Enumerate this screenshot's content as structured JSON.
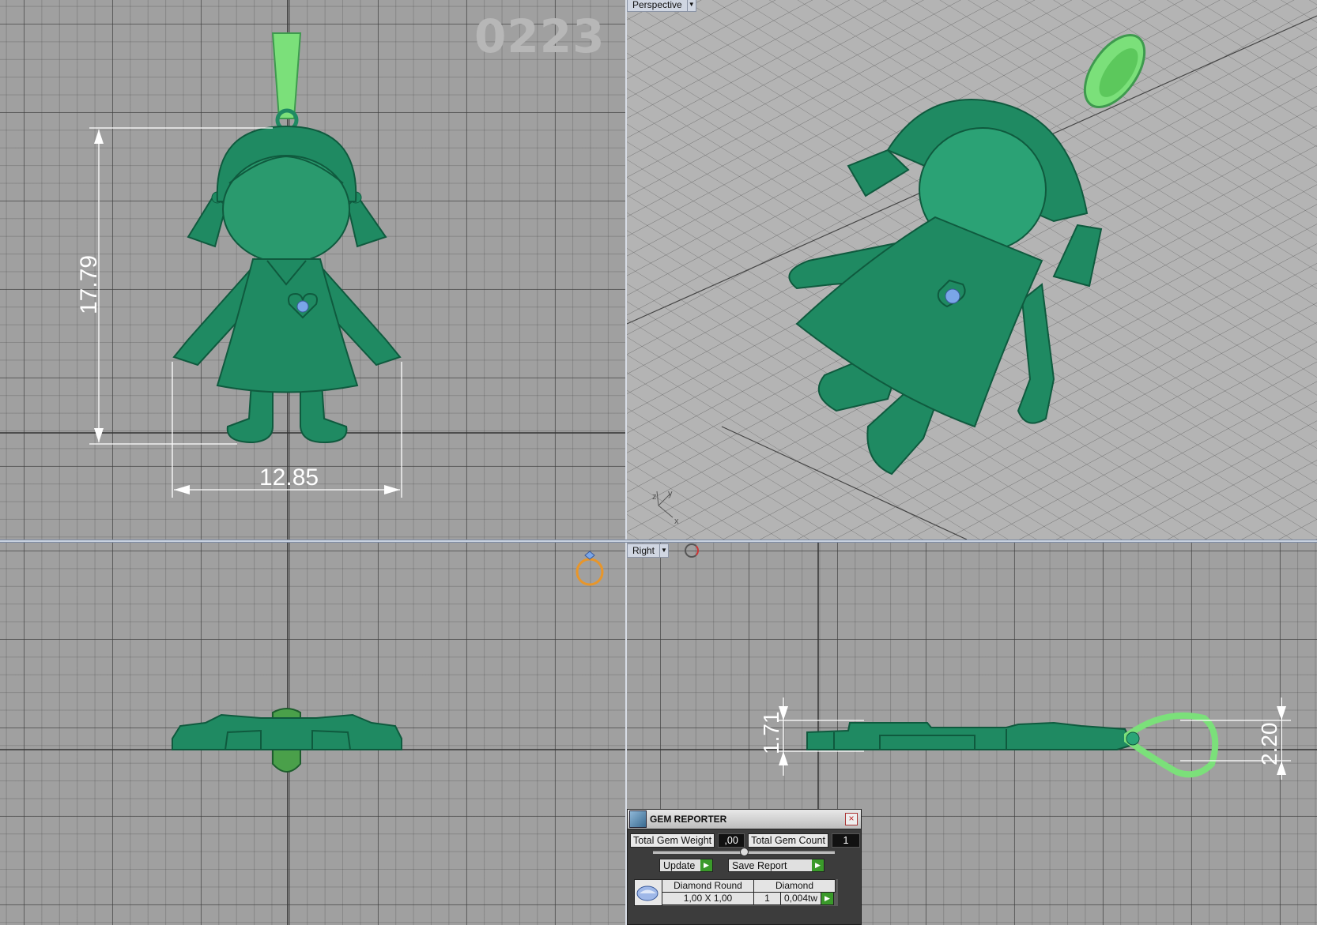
{
  "watermark": "0223",
  "viewports": {
    "top_left": {
      "dim_height": "17.79",
      "dim_width": "12.85"
    },
    "top_right": {
      "label": "Perspective",
      "axis_y": "y",
      "axis_x": "x",
      "axis_z": "z"
    },
    "bottom_right": {
      "label": "Right",
      "dim_thickness": "1.71",
      "dim_bail": "2.20"
    }
  },
  "colors": {
    "model": "#1f8a62",
    "model_light": "#2aa577",
    "bail": "#7be07a",
    "gem": "#7aa6e8",
    "dimension": "#ffffff"
  },
  "gem_reporter": {
    "title": "GEM REPORTER",
    "total_weight_label": "Total Gem Weight",
    "total_weight_value": ",00",
    "total_count_label": "Total Gem Count",
    "total_count_value": "1",
    "update_label": "Update",
    "save_label": "Save Report",
    "row": {
      "cut": "Diamond Round",
      "material": "Diamond",
      "size": "1,00 X 1,00",
      "count": "1",
      "weight": "0,004tw"
    }
  }
}
